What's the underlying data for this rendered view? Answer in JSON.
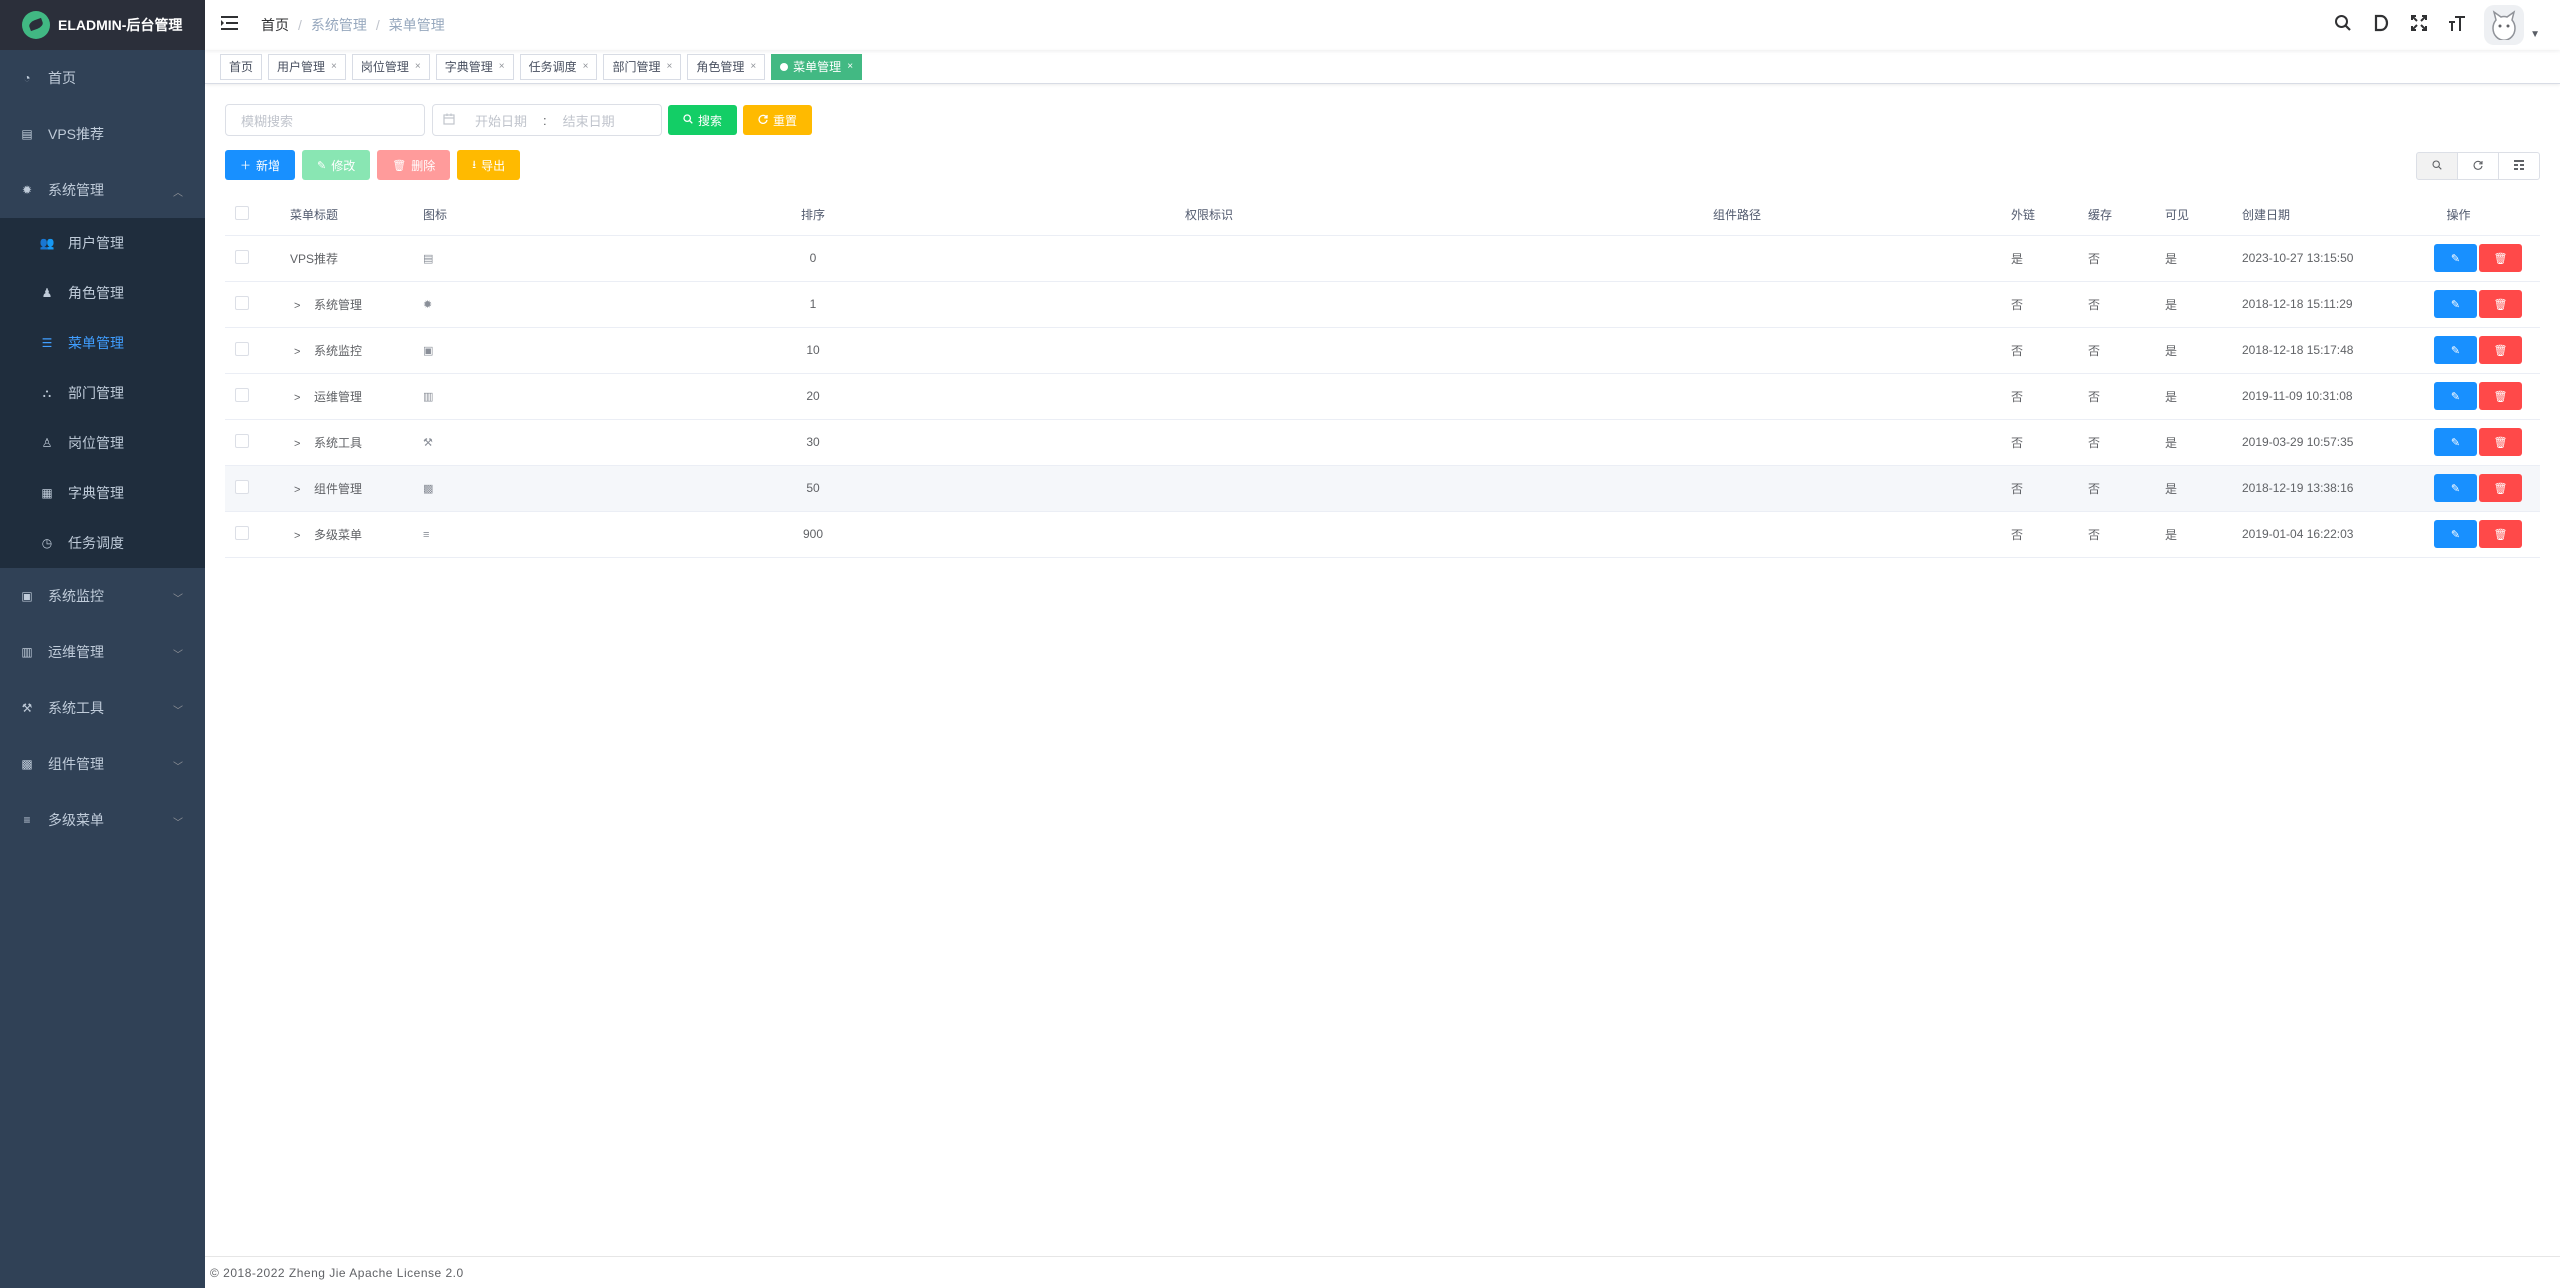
{
  "app": {
    "title": "ELADMIN-后台管理"
  },
  "sidebar": {
    "items": [
      {
        "label": "首页",
        "icon": "dashboard-icon"
      },
      {
        "label": "VPS推荐",
        "icon": "tag-icon"
      },
      {
        "label": "系统管理",
        "icon": "gear-icon",
        "expanded": true,
        "children": [
          {
            "label": "用户管理",
            "icon": "peoples-icon"
          },
          {
            "label": "角色管理",
            "icon": "role-icon"
          },
          {
            "label": "菜单管理",
            "icon": "menu-icon",
            "active": true
          },
          {
            "label": "部门管理",
            "icon": "dept-icon"
          },
          {
            "label": "岗位管理",
            "icon": "post-icon"
          },
          {
            "label": "字典管理",
            "icon": "dictionary-icon"
          },
          {
            "label": "任务调度",
            "icon": "timing-icon"
          }
        ]
      },
      {
        "label": "系统监控",
        "icon": "monitor-icon"
      },
      {
        "label": "运维管理",
        "icon": "mnt-icon"
      },
      {
        "label": "系统工具",
        "icon": "sys-tools-icon"
      },
      {
        "label": "组件管理",
        "icon": "components-icon"
      },
      {
        "label": "多级菜单",
        "icon": "list-icon"
      }
    ]
  },
  "breadcrumb": [
    "首页",
    "系统管理",
    "菜单管理"
  ],
  "tags": [
    {
      "label": "首页",
      "closable": false
    },
    {
      "label": "用户管理",
      "closable": true
    },
    {
      "label": "岗位管理",
      "closable": true
    },
    {
      "label": "字典管理",
      "closable": true
    },
    {
      "label": "任务调度",
      "closable": true
    },
    {
      "label": "部门管理",
      "closable": true
    },
    {
      "label": "角色管理",
      "closable": true
    },
    {
      "label": "菜单管理",
      "closable": true,
      "active": true
    }
  ],
  "filters": {
    "search_placeholder": "模糊搜索",
    "start_date_placeholder": "开始日期",
    "range_separator": ":",
    "end_date_placeholder": "结束日期",
    "search_button": "搜索",
    "reset_button": "重置"
  },
  "actions": {
    "add": "新增",
    "edit": "修改",
    "delete": "删除",
    "export": "导出"
  },
  "table": {
    "headers": [
      "菜单标题",
      "图标",
      "排序",
      "权限标识",
      "组件路径",
      "外链",
      "缓存",
      "可见",
      "创建日期",
      "操作"
    ],
    "rows": [
      {
        "title": "VPS推荐",
        "icon": "tag-icon",
        "sort": "0",
        "permission": "",
        "component": "",
        "iframe": "是",
        "cache": "否",
        "visible": "是",
        "created": "2023-10-27 13:15:50",
        "has_children": false
      },
      {
        "title": "系统管理",
        "icon": "gear-icon",
        "sort": "1",
        "permission": "",
        "component": "",
        "iframe": "否",
        "cache": "否",
        "visible": "是",
        "created": "2018-12-18 15:11:29",
        "has_children": true
      },
      {
        "title": "系统监控",
        "icon": "monitor-icon",
        "sort": "10",
        "permission": "",
        "component": "",
        "iframe": "否",
        "cache": "否",
        "visible": "是",
        "created": "2018-12-18 15:17:48",
        "has_children": true
      },
      {
        "title": "运维管理",
        "icon": "mnt-icon",
        "sort": "20",
        "permission": "",
        "component": "",
        "iframe": "否",
        "cache": "否",
        "visible": "是",
        "created": "2019-11-09 10:31:08",
        "has_children": true
      },
      {
        "title": "系统工具",
        "icon": "sys-tools-icon",
        "sort": "30",
        "permission": "",
        "component": "",
        "iframe": "否",
        "cache": "否",
        "visible": "是",
        "created": "2019-03-29 10:57:35",
        "has_children": true
      },
      {
        "title": "组件管理",
        "icon": "components-icon",
        "sort": "50",
        "permission": "",
        "component": "",
        "iframe": "否",
        "cache": "否",
        "visible": "是",
        "created": "2018-12-19 13:38:16",
        "has_children": true
      },
      {
        "title": "多级菜单",
        "icon": "list-icon",
        "sort": "900",
        "permission": "",
        "component": "",
        "iframe": "否",
        "cache": "否",
        "visible": "是",
        "created": "2019-01-04 16:22:03",
        "has_children": true
      }
    ]
  },
  "footer": {
    "text": "© 2018-2022 Zheng Jie Apache License 2.0"
  },
  "colors": {
    "sidebar_bg": "#304156",
    "active": "#409eff",
    "tag_active": "#42b983",
    "primary": "#1890ff",
    "danger": "#ff4949",
    "success": "#13ce66",
    "warning": "#ffba00"
  }
}
